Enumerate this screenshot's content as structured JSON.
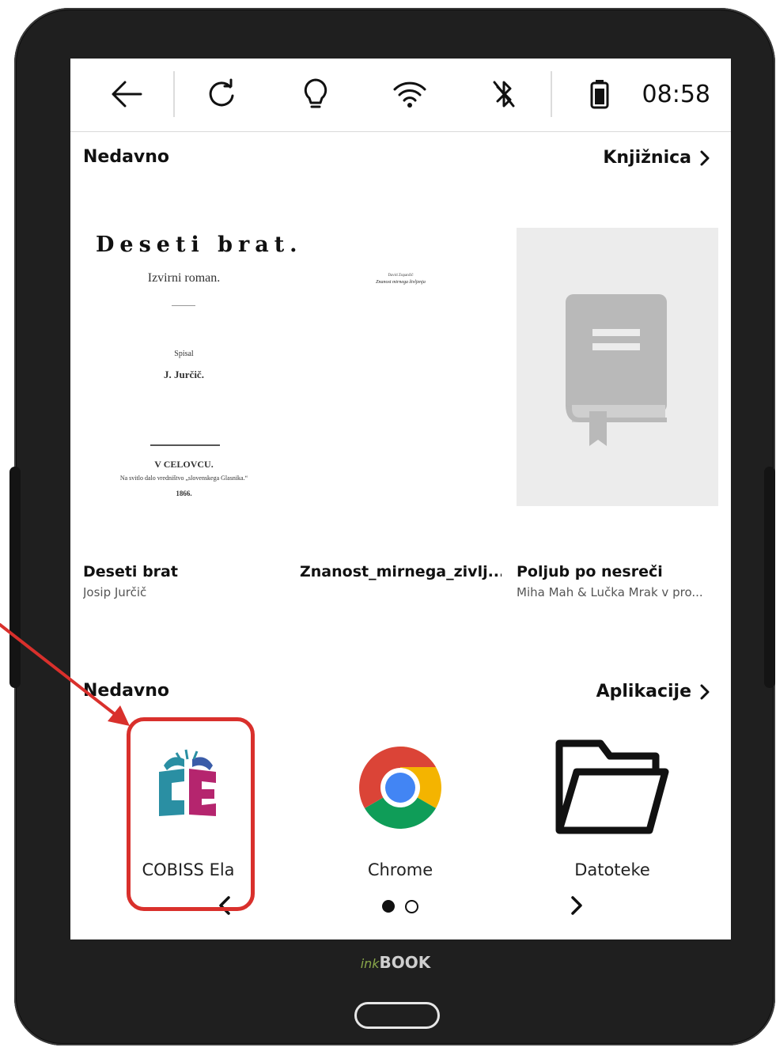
{
  "status_bar": {
    "time": "08:58",
    "icons": [
      "back-arrow-icon",
      "refresh-icon",
      "light-bulb-icon",
      "wifi-icon",
      "bluetooth-icon",
      "battery-icon"
    ]
  },
  "recent_books": {
    "title": "Nedavno",
    "link": "Knjižnica",
    "items": [
      {
        "title": "Deseti brat",
        "author": "Josip Jurčič",
        "cover": {
          "heading": "Deseti brat.",
          "subheading": "Izvirni roman.",
          "spisal": "Spisal",
          "author": "J. Jurčič.",
          "place": "V CELOVCU.",
          "publisher": "Na svitlo dalo vredništvo „slovenskega Glasnika.“",
          "year": "1866."
        }
      },
      {
        "title": "Znanost_mirnega_zivlj...",
        "author": "",
        "cover": {
          "line1": "David Zupančič",
          "line2": "Znanost mirnega življenja"
        }
      },
      {
        "title": "Poljub po nesreči",
        "author": "Miha Mah & Lučka Mrak v pro..."
      }
    ]
  },
  "recent_apps": {
    "title": "Nedavno",
    "link": "Aplikacije",
    "items": [
      {
        "label": "COBISS Ela",
        "icon": "cobiss-ela-icon",
        "colors": [
          "#2a8fa3",
          "#b5256e",
          "#3a5ca8"
        ]
      },
      {
        "label": "Chrome",
        "icon": "chrome-icon",
        "colors": [
          "#db4437",
          "#f4b400",
          "#0f9d58",
          "#4285f4"
        ]
      },
      {
        "label": "Datoteke",
        "icon": "folder-icon"
      }
    ],
    "page": 1,
    "pages": 2
  },
  "device": {
    "brand_prefix": "ink",
    "brand_name": "BOOK"
  },
  "annotation": {
    "color": "#d9302c"
  }
}
